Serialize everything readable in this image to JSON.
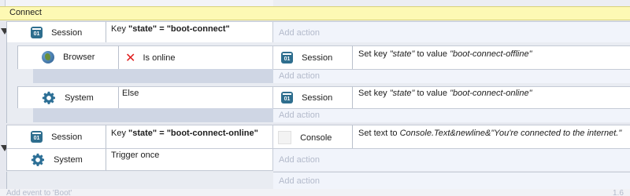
{
  "group": {
    "title": "Connect"
  },
  "events": [
    {
      "object": "Session",
      "condition": {
        "prefix": "Key ",
        "key": "\"state\"",
        "op": " = ",
        "value": "\"boot-connect\""
      },
      "add_action": "Add action",
      "subevents": [
        {
          "object": "Browser",
          "condition": "Is online",
          "action_object": "Session",
          "action_text": {
            "prefix": "Set key ",
            "key": "\"state\"",
            "mid": " to value ",
            "value": "\"boot-connect-offline\""
          },
          "add_action": "Add action"
        },
        {
          "object": "System",
          "condition": "Else",
          "action_object": "Session",
          "action_text": {
            "prefix": "Set key ",
            "key": "\"state\"",
            "mid": " to value ",
            "value": "\"boot-connect-online\""
          },
          "add_action": "Add action"
        }
      ]
    },
    {
      "conditions": [
        {
          "object": "Session",
          "text": {
            "prefix": "Key ",
            "key": "\"state\"",
            "op": " = ",
            "value": "\"boot-connect-online\""
          }
        },
        {
          "object": "System",
          "text": "Trigger once"
        }
      ],
      "action_object": "Console",
      "action_text": {
        "prefix": "Set text to ",
        "expr": "Console.Text&newline&\"You're connected to the internet.\""
      },
      "add_action": "Add action",
      "add_action_2": "Add action"
    }
  ],
  "footer": {
    "add_event": "Add event to 'Boot'",
    "right": "1.6"
  },
  "icons": {
    "object": "obj-icon",
    "browser": "globe-icon",
    "system": "gear-icon",
    "failed": "x-icon"
  }
}
